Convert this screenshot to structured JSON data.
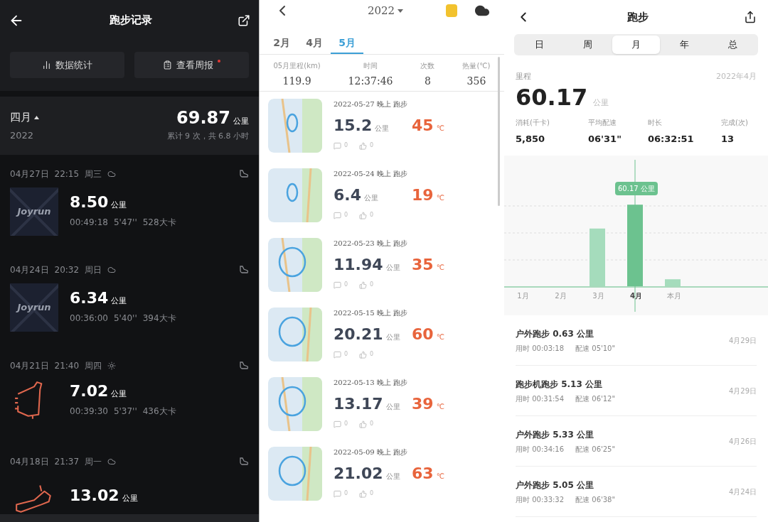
{
  "left_panel": {
    "title": "跑步记录",
    "buttons": [
      {
        "label": "数据统计",
        "kind": "stats",
        "unread": false
      },
      {
        "label": "查看周报",
        "kind": "report",
        "unread": true
      }
    ],
    "month_summary": {
      "month": "四月",
      "year": "2022",
      "distance": "69.87",
      "unit": "公里",
      "summary": "累计 9 次，共 6.8 小时"
    },
    "runs": [
      {
        "date": "04月27日",
        "time": "22:15",
        "weekday": "周三",
        "weather": {
          "kind": "cloudy"
        },
        "thumbnail": {
          "kind": "joyrun",
          "label": "Joyrun"
        },
        "distance": "8.50",
        "unit": "公里",
        "duration": "00:49:18",
        "pace": "5'47''",
        "calories": "528大卡"
      },
      {
        "date": "04月24日",
        "time": "20:32",
        "weekday": "周日",
        "weather": {
          "kind": "cloudy"
        },
        "thumbnail": {
          "kind": "joyrun",
          "label": "Joyrun"
        },
        "distance": "6.34",
        "unit": "公里",
        "duration": "00:36:00",
        "pace": "5'40''",
        "calories": "394大卡"
      },
      {
        "date": "04月21日",
        "time": "21:40",
        "weekday": "周四",
        "weather": {
          "kind": "sunny"
        },
        "thumbnail": {
          "kind": "route"
        },
        "distance": "7.02",
        "unit": "公里",
        "duration": "00:39:30",
        "pace": "5'37''",
        "calories": "436大卡"
      },
      {
        "date": "04月18日",
        "time": "21:37",
        "weekday": "周一",
        "weather": {
          "kind": "cloudy"
        },
        "thumbnail": {
          "kind": "route"
        },
        "distance": "13.02",
        "unit": "公里"
      }
    ]
  },
  "middle_panel": {
    "year": "2022",
    "tabs": [
      {
        "label": "2月",
        "selected": false
      },
      {
        "label": "4月",
        "selected": false
      },
      {
        "label": "5月",
        "selected": true
      }
    ],
    "stats": [
      {
        "label": "05月里程(km)",
        "value": "119.9"
      },
      {
        "label": "时间",
        "value": "12:37:46"
      },
      {
        "label": "次数",
        "value": "8"
      },
      {
        "label": "热量(℃)",
        "value": "356"
      }
    ],
    "entries": [
      {
        "title": "2022-05-27 晚上 跑步",
        "distance": "15.2",
        "unit": "公里",
        "heat": "45",
        "heat_unit": "℃",
        "comments": "0",
        "likes": "0"
      },
      {
        "title": "2022-05-24 晚上 跑步",
        "distance": "6.4",
        "unit": "公里",
        "heat": "19",
        "heat_unit": "℃",
        "comments": "0",
        "likes": "0"
      },
      {
        "title": "2022-05-23 晚上 跑步",
        "distance": "11.94",
        "unit": "公里",
        "heat": "35",
        "heat_unit": "℃",
        "comments": "0",
        "likes": "0"
      },
      {
        "title": "2022-05-15 晚上 跑步",
        "distance": "20.21",
        "unit": "公里",
        "heat": "60",
        "heat_unit": "℃",
        "comments": "0",
        "likes": "0"
      },
      {
        "title": "2022-05-13 晚上 跑步",
        "distance": "13.17",
        "unit": "公里",
        "heat": "39",
        "heat_unit": "℃",
        "comments": "0",
        "likes": "0"
      },
      {
        "title": "2022-05-09 晚上 跑步",
        "distance": "21.02",
        "unit": "公里",
        "heat": "63",
        "heat_unit": "℃",
        "comments": "0",
        "likes": "0"
      }
    ]
  },
  "right_panel": {
    "title": "跑步",
    "segments": [
      {
        "label": "日",
        "selected": false
      },
      {
        "label": "周",
        "selected": false
      },
      {
        "label": "月",
        "selected": true
      },
      {
        "label": "年",
        "selected": false
      },
      {
        "label": "总",
        "selected": false
      }
    ],
    "metric_label": "里程",
    "period": "2022年4月",
    "distance": "60.17",
    "unit": "公里",
    "stats": [
      {
        "label": "消耗(千卡)",
        "value": "5,850"
      },
      {
        "label": "平均配速",
        "value": "06'31\""
      },
      {
        "label": "时长",
        "value": "06:32:51"
      },
      {
        "label": "完成(次)",
        "value": "13"
      }
    ],
    "chart": {
      "tooltip": "60.17 公里",
      "months": [
        {
          "label": "1月",
          "selected": false
        },
        {
          "label": "2月",
          "selected": false
        },
        {
          "label": "3月",
          "selected": false
        },
        {
          "label": "4月",
          "selected": true
        },
        {
          "label": "本月",
          "selected": false
        }
      ]
    },
    "records": [
      {
        "title": "户外跑步 0.63 公里",
        "duration": "用时 00:03:18",
        "pace": "配速 05'10\"",
        "date": "4月29日"
      },
      {
        "title": "跑步机跑步 5.13 公里",
        "duration": "用时 00:31:54",
        "pace": "配速 06'12\"",
        "date": "4月29日"
      },
      {
        "title": "户外跑步 5.33 公里",
        "duration": "用时 00:34:16",
        "pace": "配速 06'25\"",
        "date": "4月26日"
      },
      {
        "title": "户外跑步 5.05 公里",
        "duration": "用时 00:33:32",
        "pace": "配速 06'38\"",
        "date": "4月24日"
      }
    ]
  }
}
